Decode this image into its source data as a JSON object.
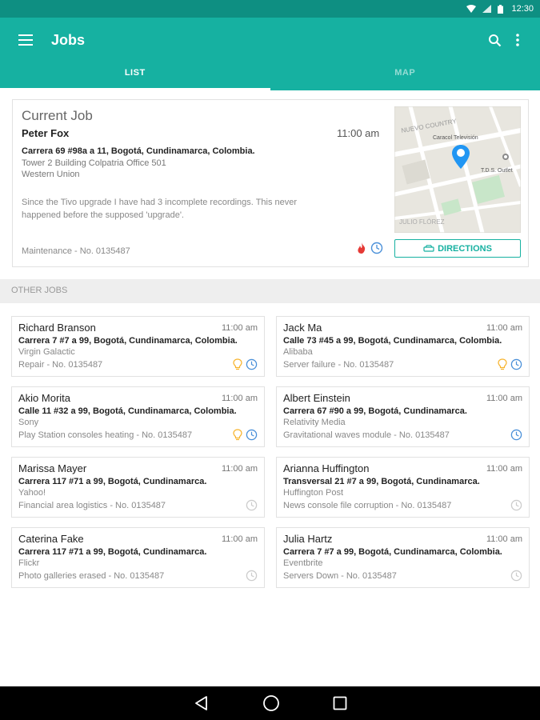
{
  "status_bar": {
    "time": "12:30"
  },
  "app_bar": {
    "title": "Jobs"
  },
  "tabs": [
    {
      "label": "LIST"
    },
    {
      "label": "MAP"
    }
  ],
  "current_job": {
    "heading": "Current Job",
    "name": "Peter Fox",
    "time": "11:00 am",
    "address": "Carrera 69 #98a a 11, Bogotá, Cundinamarca, Colombia.",
    "building": "Tower 2 Building Colpatria Office 501",
    "company": "Western Union",
    "description": "Since the Tivo upgrade I have had 3 incomplete recordings. This never happened before the supposed 'upgrade'.",
    "service": "Maintenance - No. 0135487",
    "directions_label": "DIRECTIONS",
    "map_labels": {
      "area_top": "NUEVO COUNTRY",
      "poi_1": "Caracol Televisión",
      "poi_2": "T.D.S. Outlet",
      "area_bottom": "JULIO FLÓREZ"
    }
  },
  "other_jobs": {
    "header": "OTHER JOBS",
    "jobs": [
      {
        "name": "Richard Branson",
        "time": "11:00 am",
        "address": "Carrera 7 #7 a 99, Bogotá, Cundinamarca, Colombia.",
        "company": "Virgin Galactic",
        "service": "Repair - No. 0135487"
      },
      {
        "name": "Jack Ma",
        "time": "11:00 am",
        "address": "Calle 73 #45 a 99, Bogotá, Cundinamarca, Colombia.",
        "company": "Alibaba",
        "service": "Server failure - No. 0135487"
      },
      {
        "name": "Akio Morita",
        "time": "11:00 am",
        "address": "Calle 11 #32 a 99, Bogotá, Cundinamarca, Colombia.",
        "company": "Sony",
        "service": "Play Station consoles heating - No. 0135487"
      },
      {
        "name": "Albert Einstein",
        "time": "11:00 am",
        "address": "Carrera 67 #90 a 99, Bogotá, Cundinamarca.",
        "company": "Relativity Media",
        "service": "Gravitational waves module - No. 0135487"
      },
      {
        "name": "Marissa Mayer",
        "time": "11:00 am",
        "address": "Carrera 117 #71 a 99, Bogotá, Cundinamarca.",
        "company": "Yahoo!",
        "service": "Financial area logistics - No. 0135487"
      },
      {
        "name": "Arianna Huffington",
        "time": "11:00 am",
        "address": "Transversal 21 #7 a 99, Bogotá, Cundinamarca.",
        "company": "Huffington Post",
        "service": "News console file corruption - No. 0135487"
      },
      {
        "name": "Caterina Fake",
        "time": "11:00 am",
        "address": "Carrera 117 #71 a 99, Bogotá, Cundinamarca.",
        "company": "Flickr",
        "service": "Photo galleries erased - No. 0135487"
      },
      {
        "name": "Julia Hartz",
        "time": "11:00 am",
        "address": "Carrera 7 #7 a 99, Bogotá, Cundinamarca, Colombia.",
        "company": "Eventbrite",
        "service": "Servers Down - No. 0135487"
      }
    ]
  },
  "colors": {
    "primary": "#16b1a1",
    "primary_dark": "#0e8f82",
    "alert": "#e53935",
    "bulb": "#f7b32b",
    "clock_active": "#4a90d9",
    "clock_inactive": "#cccccc"
  }
}
